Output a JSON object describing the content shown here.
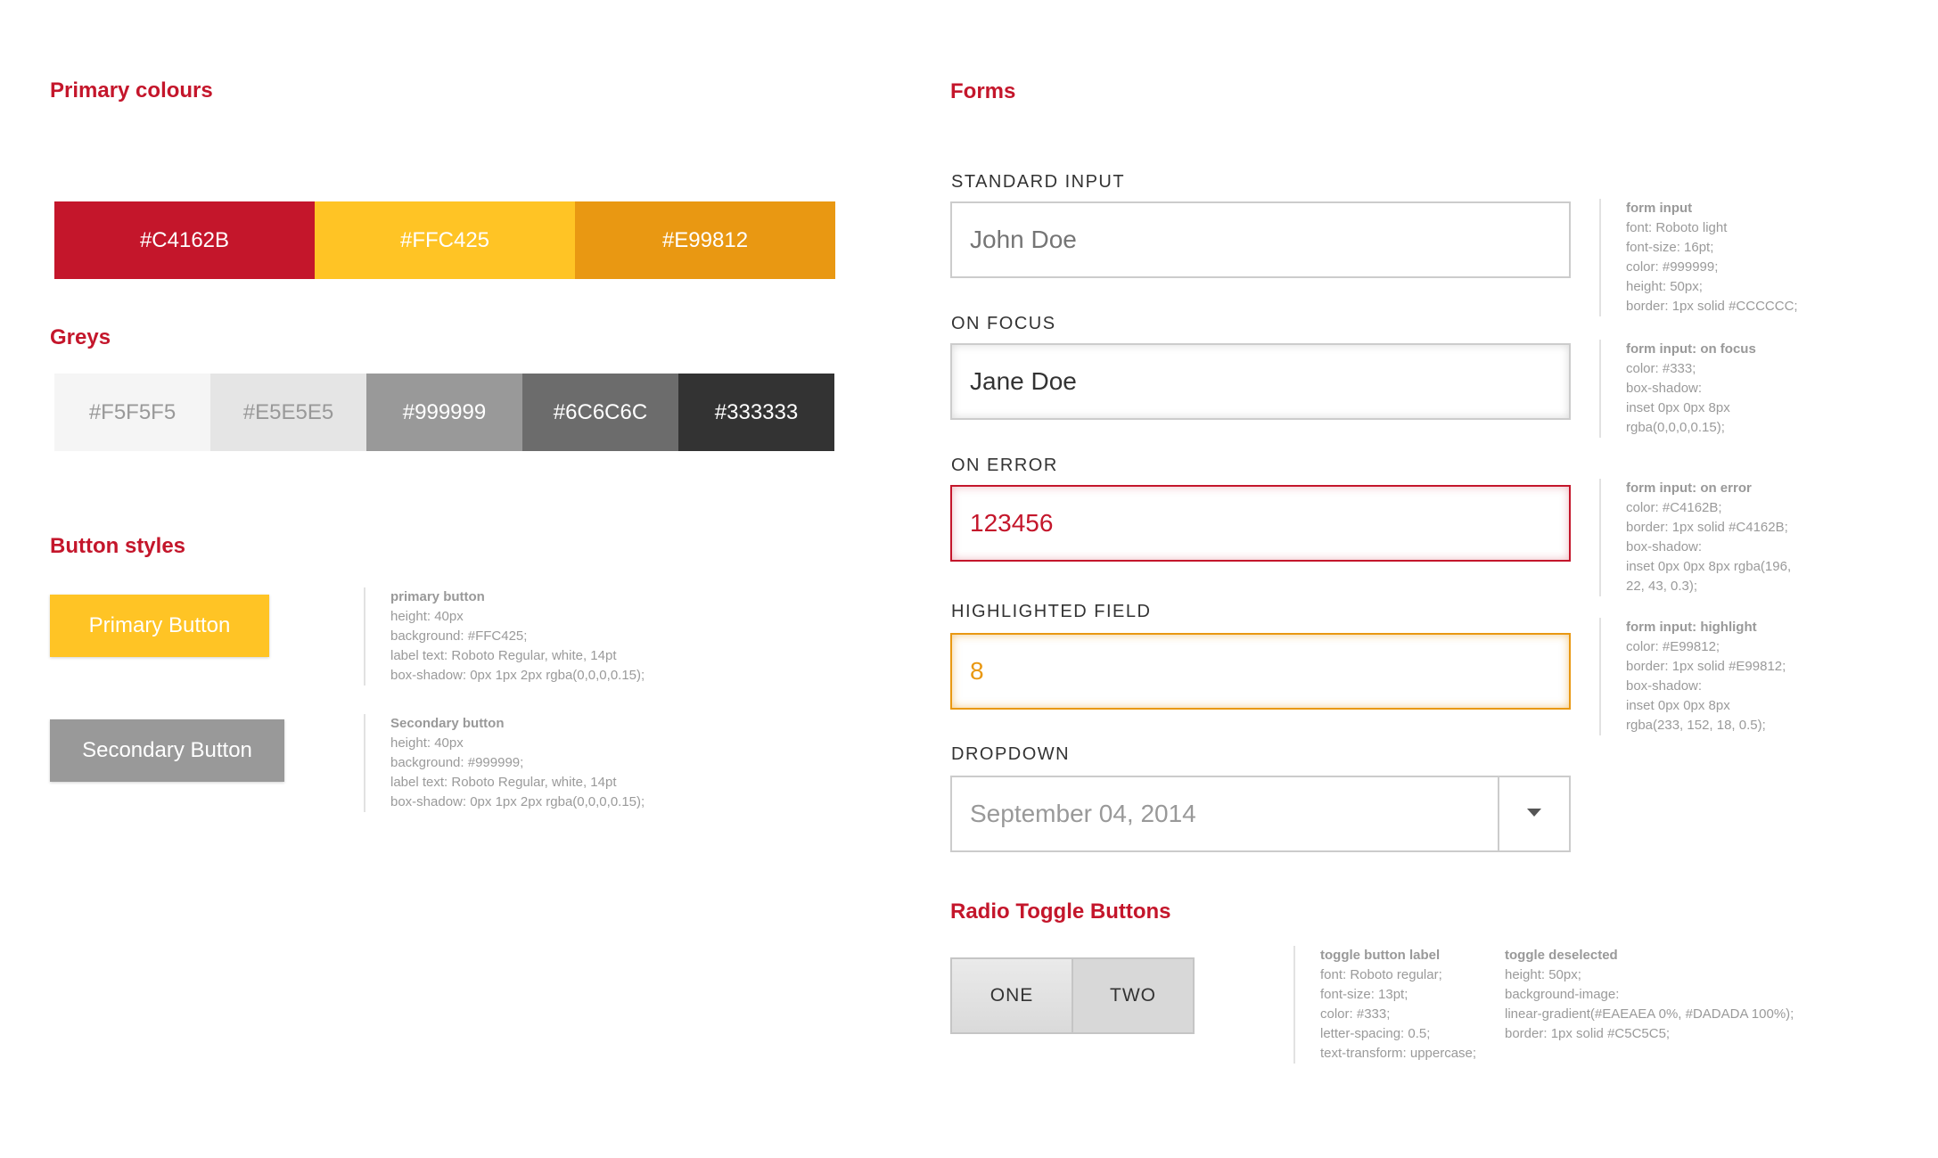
{
  "primary_colours": {
    "title": "Primary colours",
    "swatches": [
      {
        "label": "#C4162B",
        "color": "#C4162B"
      },
      {
        "label": "#FFC425",
        "color": "#FFC425"
      },
      {
        "label": "#E99812",
        "color": "#E99812"
      }
    ]
  },
  "greys": {
    "title": "Greys",
    "swatches": [
      {
        "label": "#F5F5F5",
        "color": "#F5F5F5",
        "text_color": "#999999"
      },
      {
        "label": "#E5E5E5",
        "color": "#E5E5E5",
        "text_color": "#999999"
      },
      {
        "label": "#999999",
        "color": "#999999",
        "text_color": "#ffffff"
      },
      {
        "label": "#6C6C6C",
        "color": "#6C6C6C",
        "text_color": "#ffffff"
      },
      {
        "label": "#333333",
        "color": "#333333",
        "text_color": "#ffffff"
      }
    ]
  },
  "buttons": {
    "title": "Button styles",
    "primary": {
      "label": "Primary Button",
      "spec": {
        "title": "primary button",
        "lines": [
          "height: 40px",
          "background: #FFC425;",
          "label text: Roboto Regular, white, 14pt",
          "box-shadow: 0px 1px 2px rgba(0,0,0,0.15);"
        ]
      }
    },
    "secondary": {
      "label": "Secondary Button",
      "spec": {
        "title": "Secondary button",
        "lines": [
          "height: 40px",
          "background: #999999;",
          "label text: Roboto Regular, white, 14pt",
          "box-shadow: 0px 1px 2px rgba(0,0,0,0.15);"
        ]
      }
    }
  },
  "forms": {
    "title": "Forms",
    "standard": {
      "label": "STANDARD INPUT",
      "placeholder": "John Doe",
      "spec": {
        "title": "form input",
        "lines": [
          "font: Roboto light",
          "font-size: 16pt;",
          "color: #999999;",
          "height: 50px;",
          "border: 1px solid #CCCCCC;"
        ]
      }
    },
    "focus": {
      "label": "ON FOCUS",
      "value": "Jane Doe",
      "spec": {
        "title": "form input: on focus",
        "lines": [
          "color: #333;",
          "box-shadow:",
          "inset 0px 0px 8px",
          "rgba(0,0,0,0.15);"
        ]
      }
    },
    "error": {
      "label": "ON ERROR",
      "value": "123456",
      "spec": {
        "title": "form input: on error",
        "lines": [
          "color: #C4162B;",
          "border: 1px solid #C4162B;",
          "box-shadow:",
          "inset 0px 0px 8px rgba(196,",
          "22, 43, 0.3);"
        ]
      }
    },
    "highlight": {
      "label": "HIGHLIGHTED FIELD",
      "value": "8",
      "spec": {
        "title": "form input: highlight",
        "lines": [
          "color: #E99812;",
          "border: 1px solid #E99812;",
          "box-shadow:",
          "inset 0px 0px 8px",
          "rgba(233, 152, 18, 0.5);"
        ]
      }
    },
    "dropdown": {
      "label": "DROPDOWN",
      "value": "September 04, 2014",
      "icon": "chevron-down-icon"
    }
  },
  "toggle": {
    "title": "Radio Toggle Buttons",
    "options": [
      "ONE",
      "TWO"
    ],
    "label_spec": {
      "title": "toggle button label",
      "lines": [
        "font: Roboto regular;",
        "font-size: 13pt;",
        "color: #333;",
        "letter-spacing: 0.5;",
        "text-transform: uppercase;"
      ]
    },
    "deselected_spec": {
      "title": "toggle deselected",
      "lines": [
        "height: 50px;",
        "background-image:",
        "linear-gradient(#EAEAEA 0%, #DADADA 100%);",
        "border: 1px solid #C5C5C5;"
      ]
    }
  }
}
